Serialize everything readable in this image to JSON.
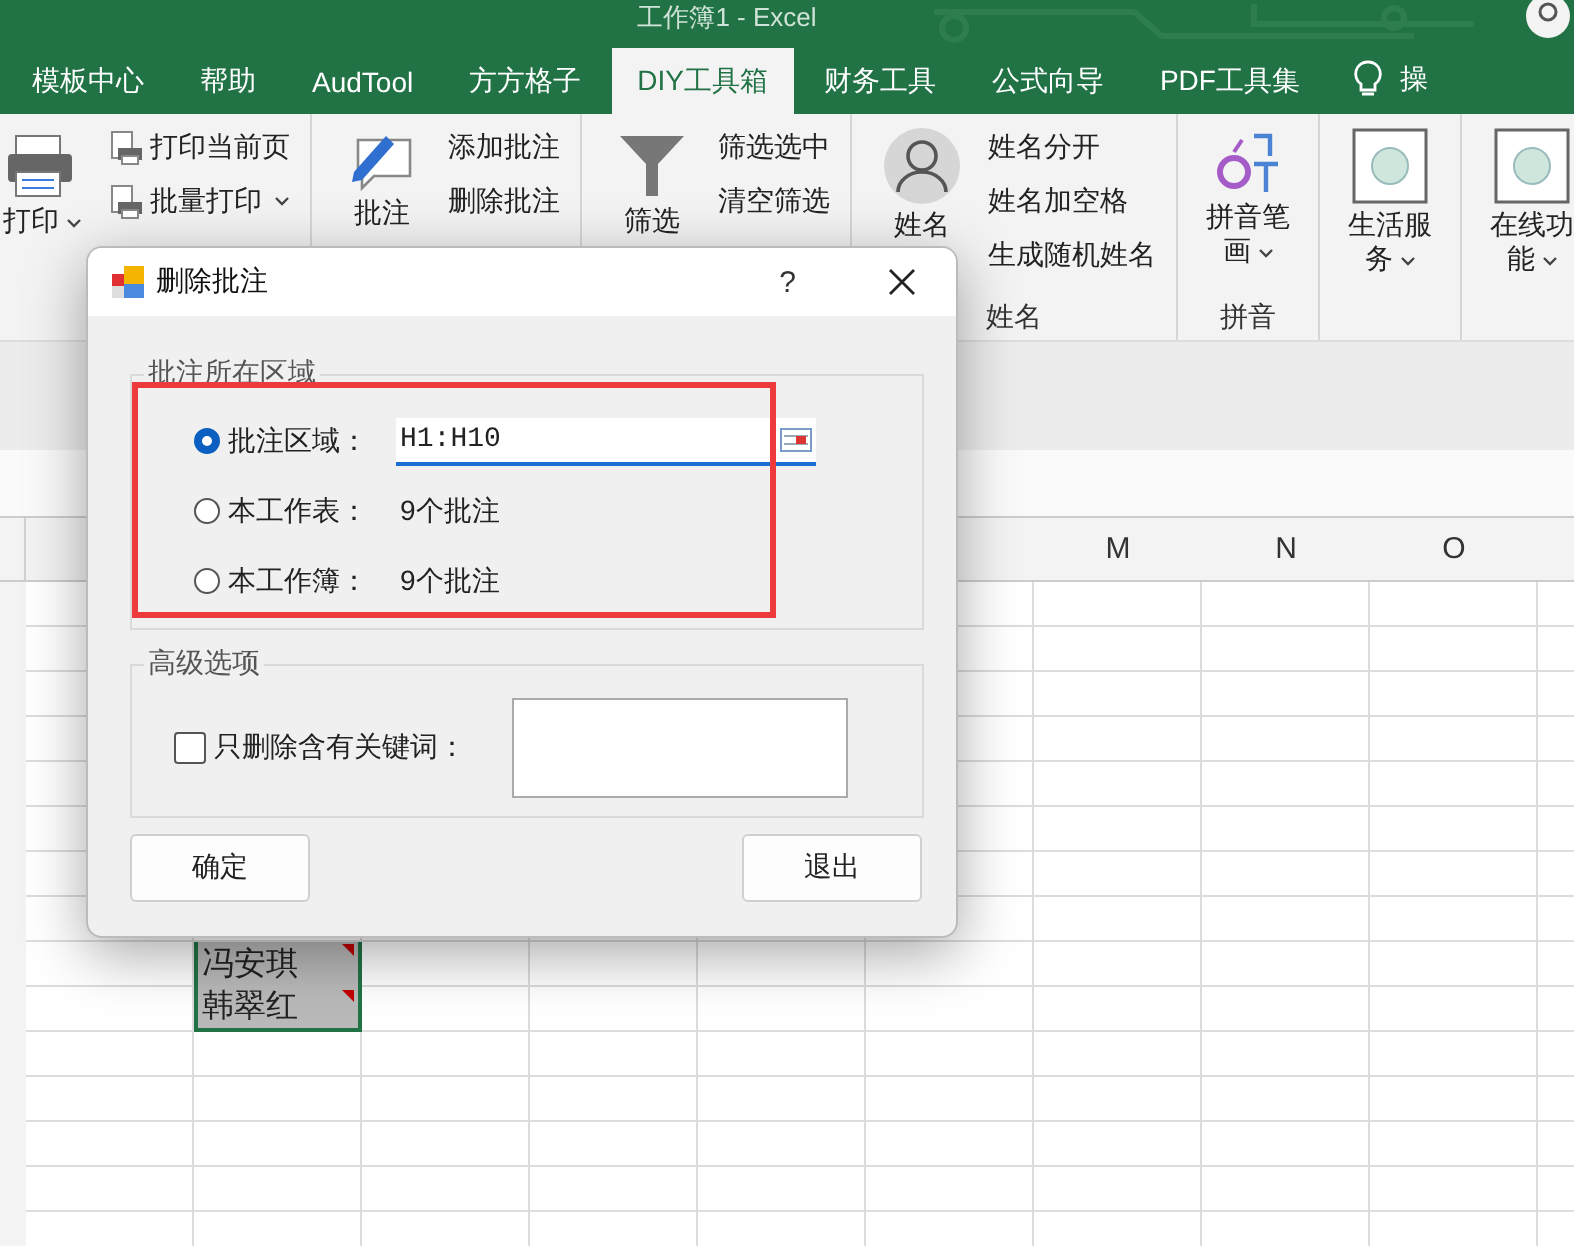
{
  "window": {
    "title": "工作簿1 - Excel"
  },
  "ribbon_tabs": [
    {
      "label": "模板中心",
      "selected": false
    },
    {
      "label": "帮助",
      "selected": false
    },
    {
      "label": "AudTool",
      "selected": false
    },
    {
      "label": "方方格子",
      "selected": false
    },
    {
      "label": "DIY工具箱",
      "selected": true
    },
    {
      "label": "财务工具",
      "selected": false
    },
    {
      "label": "公式向导",
      "selected": false
    },
    {
      "label": "PDF工具集",
      "selected": false
    }
  ],
  "tell_me": "操",
  "ribbon_groups": [
    {
      "large": {
        "label": "打印",
        "dropdown": true
      },
      "small": [
        {
          "label": "打印当前页",
          "dropdown": false
        },
        {
          "label": "批量打印",
          "dropdown": true
        }
      ]
    },
    {
      "large": {
        "label": "批注",
        "dropdown": false
      },
      "small": [
        {
          "label": "添加批注",
          "dropdown": false
        },
        {
          "label": "删除批注",
          "dropdown": false
        }
      ]
    },
    {
      "large": {
        "label": "筛选",
        "dropdown": false
      },
      "small": [
        {
          "label": "筛选选中",
          "dropdown": false
        },
        {
          "label": "清空筛选",
          "dropdown": false
        }
      ]
    },
    {
      "large": {
        "label": "姓名",
        "dropdown": false
      },
      "small": [
        {
          "label": "姓名分开",
          "dropdown": false
        },
        {
          "label": "姓名加空格",
          "dropdown": false
        },
        {
          "label": "生成随机姓名",
          "dropdown": false
        }
      ],
      "label": "姓名"
    },
    {
      "large": {
        "label": "拼音笔画",
        "dropdown": true
      },
      "label": "拼音"
    },
    {
      "large": {
        "label": "生活服务",
        "dropdown": true
      }
    },
    {
      "large": {
        "label": "在线功能",
        "dropdown": true
      }
    }
  ],
  "sheet": {
    "columns": [
      "M",
      "N",
      "O"
    ],
    "cells": [
      {
        "text": "冯安琪",
        "has_comment": true
      },
      {
        "text": "韩翠红",
        "has_comment": true
      }
    ]
  },
  "dialog": {
    "title": "删除批注",
    "help": "?",
    "range_group": {
      "title": "批注所在区域",
      "options": [
        {
          "kind": "field",
          "label": "批注区域：",
          "selected": true,
          "value": "H1:H10"
        },
        {
          "kind": "count",
          "label": "本工作表：",
          "selected": false,
          "count": "9个批注"
        },
        {
          "kind": "count",
          "label": "本工作簿：",
          "selected": false,
          "count": "9个批注"
        }
      ]
    },
    "advanced_group": {
      "title": "高级选项",
      "keyword_option": {
        "label": "只删除含有关键词：",
        "checked": false
      }
    },
    "buttons": [
      "确定",
      "退出"
    ]
  }
}
